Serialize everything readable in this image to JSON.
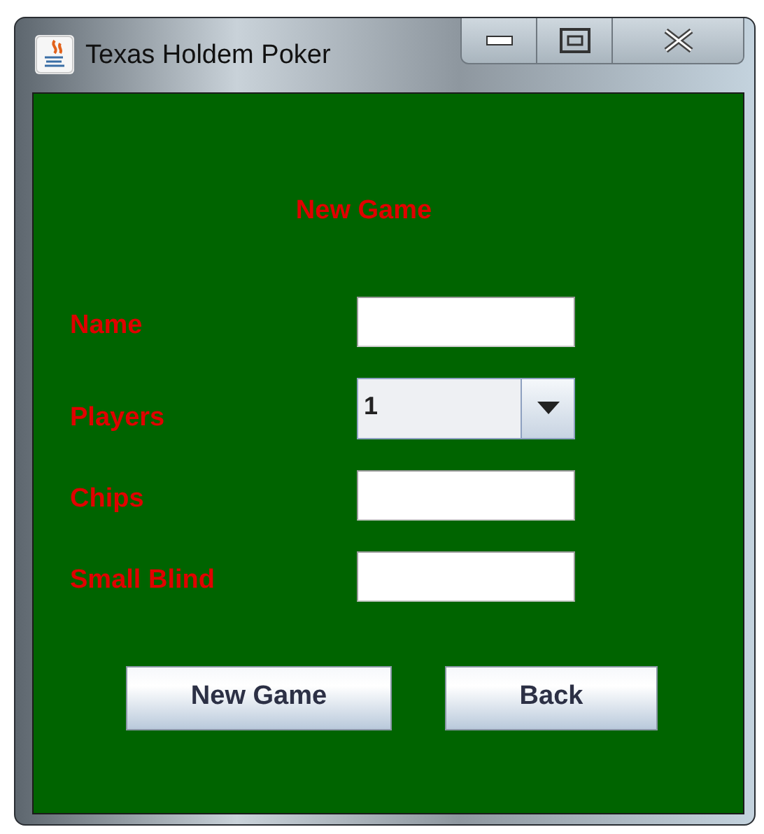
{
  "window": {
    "title": "Texas Holdem Poker"
  },
  "heading": "New Game",
  "fields": [
    {
      "label": "Name",
      "kind": "text"
    },
    {
      "label": "Players",
      "kind": "select",
      "value": "1"
    },
    {
      "label": "Chips",
      "kind": "text"
    },
    {
      "label": "Small Blind",
      "kind": "text"
    }
  ],
  "buttons": [
    "New Game",
    "Back"
  ]
}
